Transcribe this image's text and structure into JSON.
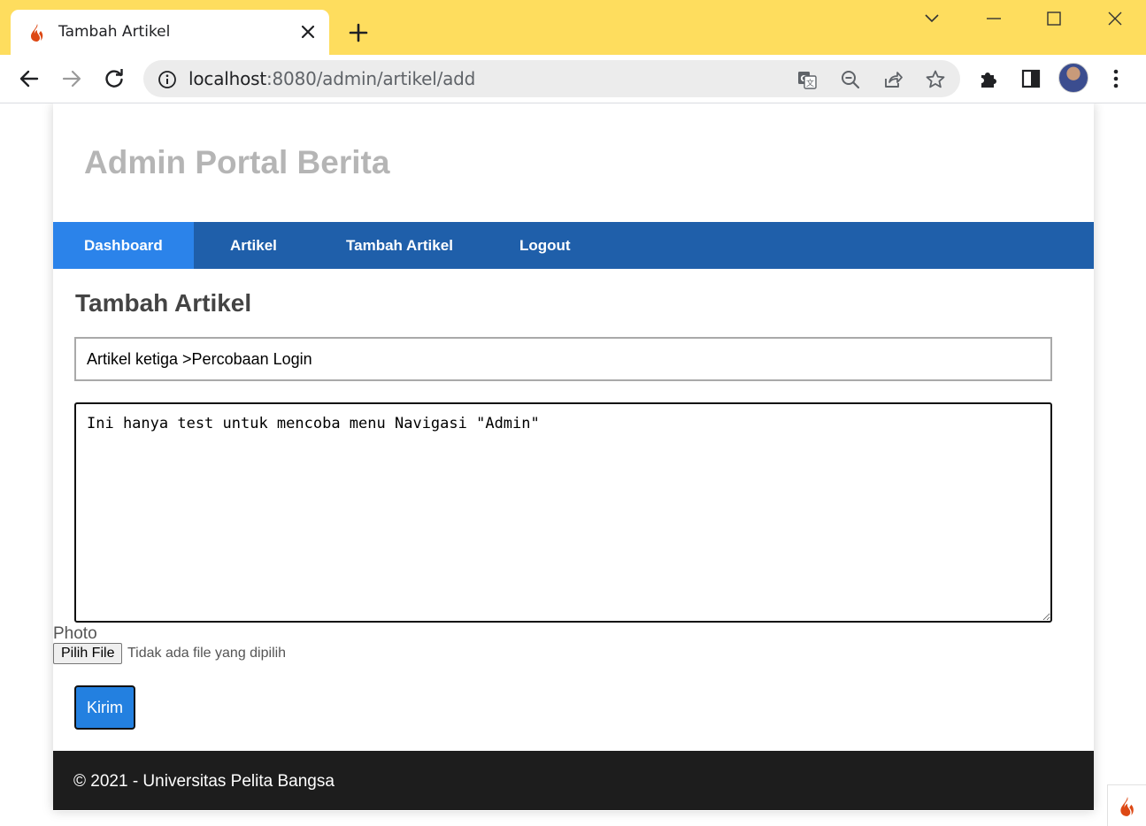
{
  "browser": {
    "tab_title": "Tambah Artikel",
    "url_host": "localhost",
    "url_path": ":8080/admin/artikel/add",
    "icons": [
      "back-arrow-icon",
      "forward-arrow-icon",
      "reload-icon",
      "info-icon",
      "translate-icon",
      "zoom-out-icon",
      "share-icon",
      "star-icon",
      "extensions-icon",
      "sidebar-icon",
      "profile-avatar",
      "more-menu-icon"
    ]
  },
  "site": {
    "title": "Admin Portal Berita"
  },
  "nav": {
    "items": [
      {
        "label": "Dashboard",
        "active": true
      },
      {
        "label": "Artikel",
        "active": false
      },
      {
        "label": "Tambah Artikel",
        "active": false
      },
      {
        "label": "Logout",
        "active": false
      }
    ]
  },
  "form": {
    "heading": "Tambah Artikel",
    "title_value": "Artikel ketiga >Percobaan Login",
    "content_value": "Ini hanya test untuk mencoba menu Navigasi \"Admin\"",
    "photo_label": "Photo",
    "file_button_label": "Pilih File",
    "file_status": "Tidak ada file yang dipilih",
    "submit_label": "Kirim"
  },
  "footer": {
    "text": "© 2021 - Universitas Pelita Bangsa"
  },
  "colors": {
    "titlebar": "#fedd5e",
    "navbar": "#1f5faa",
    "nav_active": "#2b83ea",
    "submit": "#2380e0",
    "footer": "#1d1d1d"
  }
}
